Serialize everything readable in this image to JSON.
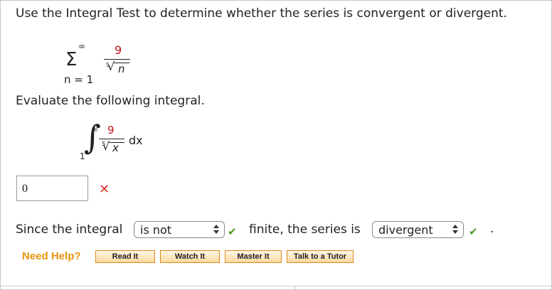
{
  "question": {
    "text": "Use the Integral Test to determine whether the series is convergent or divergent."
  },
  "series": {
    "sigma": "Σ",
    "upper_limit": "∞",
    "lower_limit": "n = 1",
    "numerator": "9",
    "root_index": "5",
    "radicand": "n"
  },
  "integral_prompt": "Evaluate the following integral.",
  "integral": {
    "sign": "∫",
    "upper_limit": "∞",
    "lower_limit": "1",
    "numerator": "9",
    "root_index": "5",
    "radicand": "x",
    "differential": "dx"
  },
  "answer": {
    "value": "0",
    "status_icon": "x-mark-icon",
    "status_color": "#e0342a"
  },
  "conclusion": {
    "prefix": "Since the integral",
    "select1_value": "is not",
    "middle": "finite, the series is",
    "select2_value": "divergent",
    "suffix": ".",
    "check_color": "#4a9a26"
  },
  "help": {
    "label": "Need Help?",
    "buttons": [
      "Read It",
      "Watch It",
      "Master It",
      "Talk to a Tutor"
    ],
    "accent": "#e8930f"
  }
}
